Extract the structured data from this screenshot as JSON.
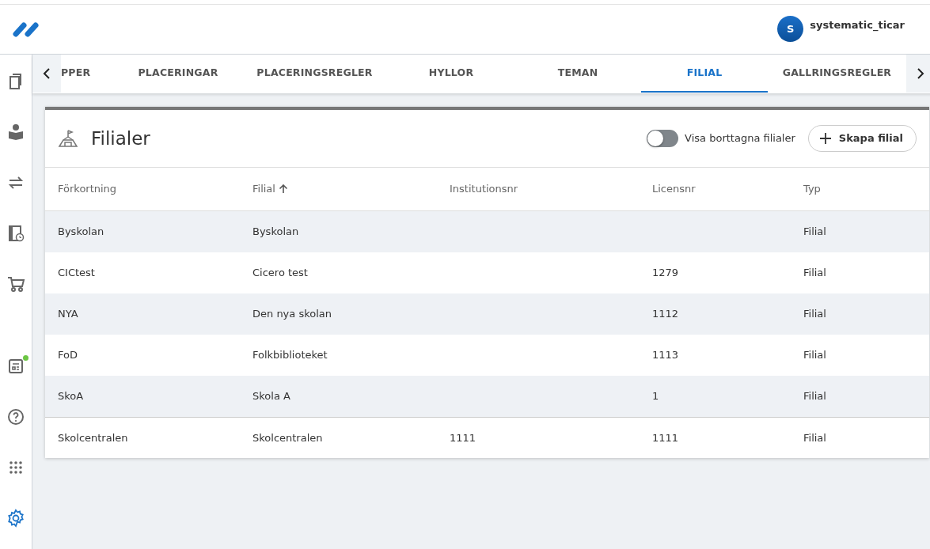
{
  "header": {
    "user": {
      "initial": "S",
      "name": "systematic_ticar"
    }
  },
  "sidebar": {
    "items": [
      {
        "kind": "books",
        "selected": false,
        "notification": false
      },
      {
        "kind": "reader",
        "selected": false,
        "notification": false
      },
      {
        "kind": "exchange",
        "selected": false,
        "notification": false
      },
      {
        "kind": "bookclock",
        "selected": false,
        "notification": false
      },
      {
        "kind": "cart",
        "selected": false,
        "notification": false
      },
      {
        "kind": "report",
        "selected": false,
        "notification": true
      },
      {
        "kind": "help",
        "selected": false,
        "notification": false
      },
      {
        "kind": "apps",
        "selected": false,
        "notification": false
      },
      {
        "kind": "settings",
        "selected": true,
        "notification": false
      }
    ]
  },
  "tabs": [
    {
      "label": "PPER",
      "selected": false
    },
    {
      "label": "PLACERINGAR",
      "selected": false
    },
    {
      "label": "PLACERINGSREGLER",
      "selected": false
    },
    {
      "label": "HYLLOR",
      "selected": false
    },
    {
      "label": "TEMAN",
      "selected": false
    },
    {
      "label": "FILIAL",
      "selected": true
    },
    {
      "label": "GALLRINGSREGLER",
      "selected": false
    }
  ],
  "panel": {
    "title": "Filialer",
    "toggle": {
      "label": "Visa borttagna filialer",
      "on": false
    },
    "create_button": "Skapa filial",
    "table": {
      "columns": [
        {
          "label": "Förkortning",
          "sorted": false
        },
        {
          "label": "Filial",
          "sorted": true
        },
        {
          "label": "Institutionsnr",
          "sorted": false
        },
        {
          "label": "Licensnr",
          "sorted": false
        },
        {
          "label": "Typ",
          "sorted": false
        }
      ],
      "rows": [
        [
          "Byskolan",
          "Byskolan",
          "",
          "",
          "Filial"
        ],
        [
          "CICtest",
          "Cicero test",
          "",
          "1279",
          "Filial"
        ],
        [
          "NYA",
          "Den nya skolan",
          "",
          "1112",
          "Filial"
        ],
        [
          "FoD",
          "Folkbiblioteket",
          "",
          "1113",
          "Filial"
        ],
        [
          "SkoA",
          "Skola A",
          "",
          "1",
          "Filial"
        ],
        [
          "Skolcentralen",
          "Skolcentralen",
          "1111",
          "1111",
          "Filial"
        ]
      ]
    }
  }
}
